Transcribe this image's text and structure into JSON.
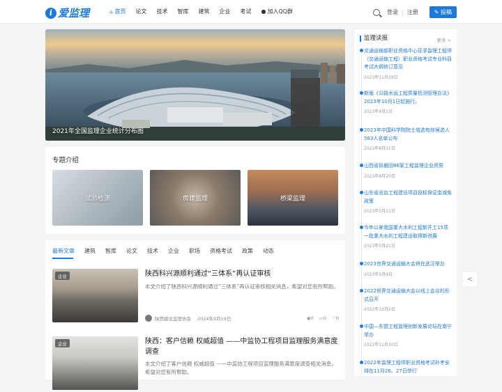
{
  "logo": {
    "mark": "i",
    "text": "爱监理"
  },
  "nav": [
    "首页",
    "论文",
    "技术",
    "智库",
    "建筑",
    "企业",
    "考试",
    "加入QQ群"
  ],
  "header": {
    "login": "登录",
    "register": "注册",
    "post": "投稿"
  },
  "hero": {
    "caption": "2021年全国监理企业统计分布图"
  },
  "topics": {
    "title": "专题介绍",
    "tiles": [
      "试验检测",
      "房建监理",
      "桥梁监理"
    ]
  },
  "feed": {
    "tabs": [
      "最新文章",
      "建筑",
      "智库",
      "论文",
      "技术",
      "企业",
      "职场",
      "资格考试",
      "政策",
      "动态"
    ],
    "articles": [
      {
        "tag": "企业",
        "title": "陕西科兴源顺利通过“三体系”再认证审核",
        "desc": "本文介绍了陕西科兴源顺利通过“三体系”再认证审核相关消息，希望对您有所帮助。",
        "author": "陕西建设监理协会",
        "date": "2024年9月19日",
        "views": "0",
        "comments": "0",
        "likes": "0"
      },
      {
        "tag": "企业",
        "title": "陕西：客户信赖 权威超值 ——中监协工程项目监理服务满意度调查",
        "desc": "本文介绍了客户信赖 权威超值 ——中监协工程项目监理服务满意度调查相关消息，希望对您有所帮助。"
      }
    ]
  },
  "sidebar": {
    "title": "监理读报",
    "more": "更多 >",
    "items": [
      {
        "title": "交通运输部职业资格中心征求监理工程师（交通运输工程）职业资格考试专业科目考试大纲修订意见",
        "date": "2023年11月29日"
      },
      {
        "title": "新版《公路水运工程质量检测管理办法》2023年10月1日起施行。",
        "date": "2023年9月1日"
      },
      {
        "title": "2023年中国科学院院士增选有效候选人583人名单公布",
        "date": "2023年8月31日"
      },
      {
        "title": "山西省拟撤回86家工程监理企业资质",
        "date": "2023年8月20日"
      },
      {
        "title": "山东省出台工程建设项目投标保证金减免政策",
        "date": "2023年5月21日"
      },
      {
        "title": "今年以来我国重大水利工程新开工15项 一批重大水利工程建设取得新进展",
        "date": "2023年5月21日"
      },
      {
        "title": "2023世界交通运输大会将在武汉举办",
        "date": "2023年5月9日"
      },
      {
        "title": "2022世界交通运输大会以线上会议的形式召开",
        "date": "2022年12月2日"
      },
      {
        "title": "中国—东盟工程监理创新发展论坛在南宁举办",
        "date": "2022年11月30日"
      },
      {
        "title": "2022年监理工程师职业资格考试补考安排在11月26、27日举行",
        "date": ""
      }
    ]
  },
  "colors": {
    "accent": "#1d7ad8"
  }
}
